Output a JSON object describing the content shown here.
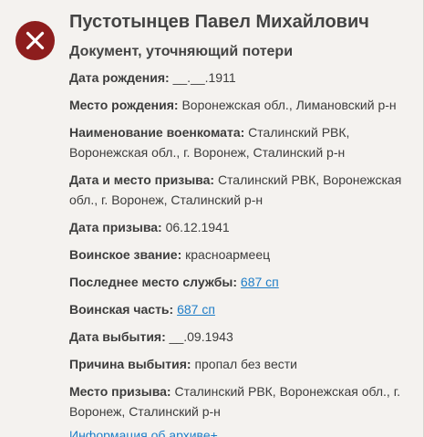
{
  "record": {
    "name": "Пустотынцев Павел Михайлович",
    "doc_type": "Документ, уточняющий потери",
    "status_icon": "close-icon",
    "status_color": "#8d1d1d",
    "fields": {
      "birth_date": {
        "label": "Дата рождения:",
        "value": "__.__.1911"
      },
      "birth_place": {
        "label": "Место рождения:",
        "value": "Воронежская обл., Лимановский р-н"
      },
      "commissariat": {
        "label": "Наименование военкомата:",
        "value": "Сталинский РВК, Воронежская обл., г. Воронеж, Сталинский р-н"
      },
      "draft_date_place": {
        "label": "Дата и место призыва:",
        "value": "Сталинский РВК, Воронежская обл., г. Воронеж, Сталинский р-н"
      },
      "draft_date": {
        "label": "Дата призыва:",
        "value": "06.12.1941"
      },
      "rank": {
        "label": "Воинское звание:",
        "value": "красноармеец"
      },
      "last_service": {
        "label": "Последнее место службы:",
        "value": "687 сп"
      },
      "unit": {
        "label": "Воинская часть:",
        "value": "687 сп"
      },
      "departure_date": {
        "label": "Дата выбытия:",
        "value": "__.09.1943"
      },
      "departure_reason": {
        "label": "Причина выбытия:",
        "value": "пропал без вести"
      },
      "draft_place": {
        "label": "Место призыва:",
        "value": "Сталинский РВК, Воронежская обл., г. Воронеж, Сталинский р-н"
      }
    },
    "archive_link": "Информация об архиве+"
  },
  "colors": {
    "link": "#1e7dc7",
    "background": "#f4f2ef"
  }
}
